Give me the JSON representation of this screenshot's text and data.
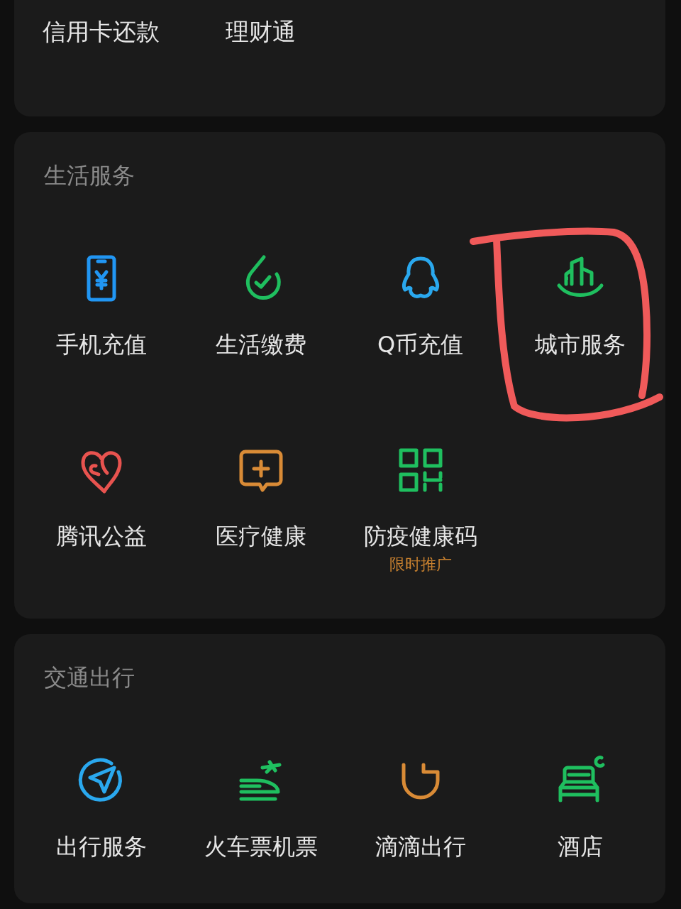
{
  "sections": [
    {
      "items": [
        {
          "label": "信用卡还款"
        },
        {
          "label": "理财通"
        }
      ]
    },
    {
      "title": "生活服务",
      "items": [
        {
          "label": "手机充值",
          "color": "#2196f3",
          "highlighted": false
        },
        {
          "label": "生活缴费",
          "color": "#1fbf5f",
          "highlighted": false
        },
        {
          "label": "Q币充值",
          "color": "#2aa8ee",
          "highlighted": false
        },
        {
          "label": "城市服务",
          "color": "#1fbf5f",
          "highlighted": true
        },
        {
          "label": "腾讯公益",
          "color": "#e8534f",
          "highlighted": false
        },
        {
          "label": "医疗健康",
          "color": "#d98b36",
          "highlighted": false
        },
        {
          "label": "防疫健康码",
          "sublabel": "限时推广",
          "color": "#1fbf5f",
          "highlighted": false
        }
      ]
    },
    {
      "title": "交通出行",
      "items": [
        {
          "label": "出行服务",
          "color": "#2aa8ee",
          "highlighted": false
        },
        {
          "label": "火车票机票",
          "color": "#1fbf5f",
          "highlighted": false
        },
        {
          "label": "滴滴出行",
          "color": "#d98b36",
          "highlighted": false
        },
        {
          "label": "酒店",
          "color": "#1fbf5f",
          "highlighted": false
        }
      ]
    }
  ]
}
